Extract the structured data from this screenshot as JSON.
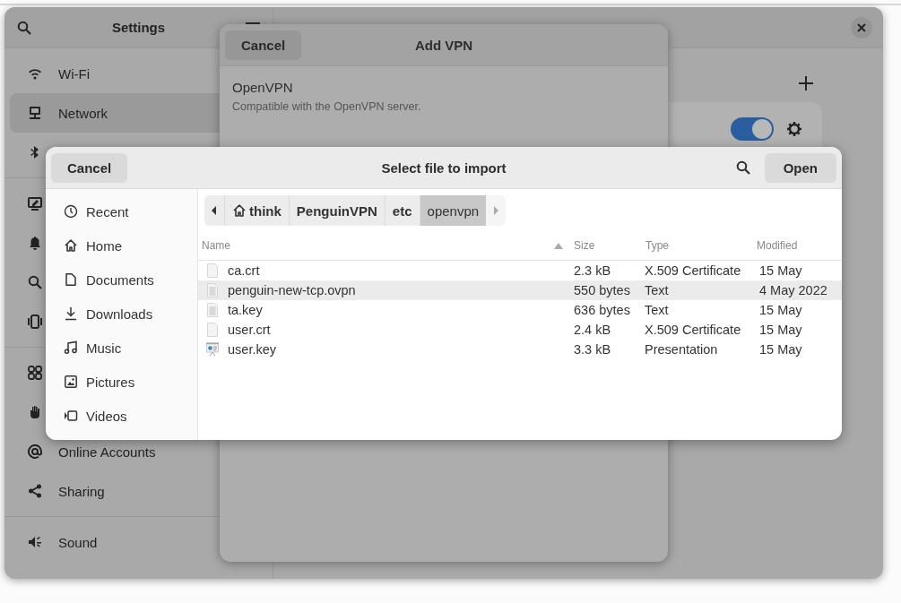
{
  "settings": {
    "title": "Settings",
    "sidebar": {
      "groups": [
        {
          "items": [
            {
              "label": "Wi-Fi",
              "selected": false
            },
            {
              "label": "Network",
              "selected": true
            },
            {
              "selected": false
            }
          ]
        },
        {
          "items": [
            {
              "selected": false
            },
            {
              "selected": false
            },
            {
              "selected": false
            },
            {
              "selected": false
            }
          ]
        },
        {
          "items": [
            {
              "selected": false
            },
            {
              "selected": false
            },
            {
              "label": "Online Accounts",
              "selected": false
            },
            {
              "label": "Sharing",
              "selected": false
            }
          ]
        },
        {
          "items": [
            {
              "label": "Sound",
              "selected": false
            }
          ]
        }
      ]
    },
    "network": {
      "vpn_switch": {
        "on": true
      }
    }
  },
  "add_vpn": {
    "cancel": "Cancel",
    "title": "Add VPN",
    "option": {
      "title": "OpenVPN",
      "description": "Compatible with the OpenVPN server."
    }
  },
  "file_dialog": {
    "cancel": "Cancel",
    "title": "Select file to import",
    "open": "Open",
    "places": [
      "Recent",
      "Home",
      "Documents",
      "Downloads",
      "Music",
      "Pictures",
      "Videos"
    ],
    "path": [
      {
        "label": "think",
        "selected": false
      },
      {
        "label": "PenguinVPN",
        "selected": false
      },
      {
        "label": "etc",
        "selected": false
      },
      {
        "label": "openvpn",
        "selected": true
      }
    ],
    "columns": [
      {
        "label": "Name",
        "sorted": true
      },
      {
        "label": "Size",
        "sorted": false
      },
      {
        "label": "Type",
        "sorted": false
      },
      {
        "label": "Modified",
        "sorted": false
      }
    ],
    "files": [
      {
        "name": "ca.crt",
        "size": "2.3 kB",
        "type": "X.509 Certificate",
        "modified": "15 May",
        "kind": "blank",
        "selected": false
      },
      {
        "name": "penguin-new-tcp.ovpn",
        "size": "550 bytes",
        "type": "Text",
        "modified": "4 May 2022",
        "kind": "text",
        "selected": true
      },
      {
        "name": "ta.key",
        "size": "636 bytes",
        "type": "Text",
        "modified": "15 May",
        "kind": "text",
        "selected": false
      },
      {
        "name": "user.crt",
        "size": "2.4 kB",
        "type": "X.509 Certificate",
        "modified": "15 May",
        "kind": "blank",
        "selected": false
      },
      {
        "name": "user.key",
        "size": "3.3 kB",
        "type": "Presentation",
        "modified": "15 May",
        "kind": "presentation",
        "selected": false
      }
    ]
  }
}
